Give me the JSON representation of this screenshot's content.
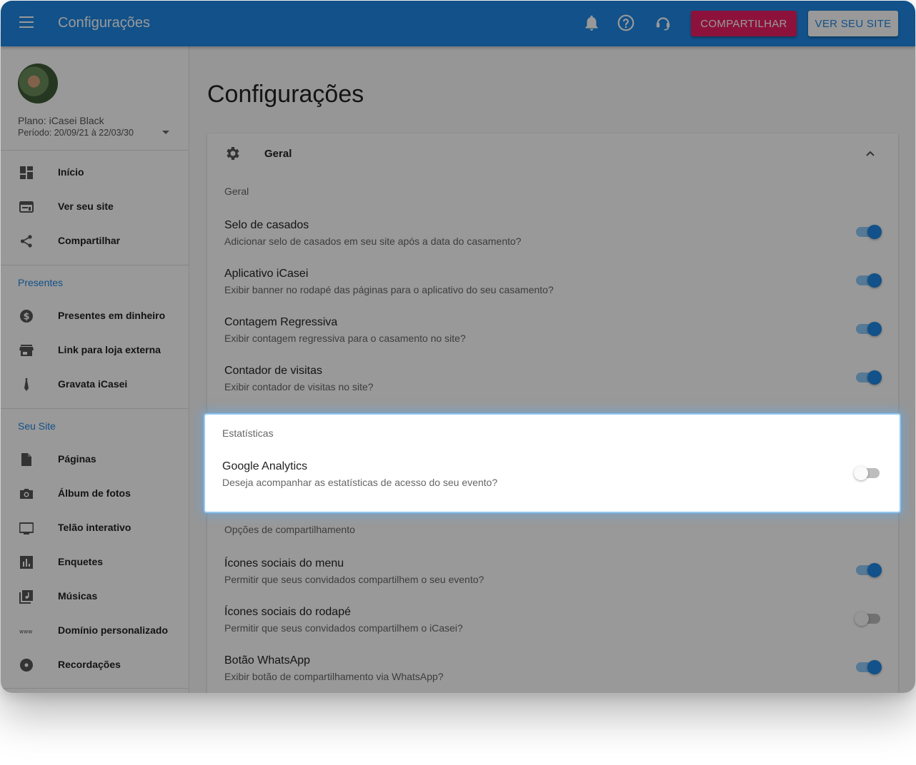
{
  "header": {
    "title": "Configurações",
    "share_label": "COMPARTILHAR",
    "view_site_label": "VER SEU SITE",
    "brand_color": "#1e88e5",
    "accent_color": "#e91e63"
  },
  "sidebar": {
    "plan": "Plano: iCasei Black",
    "period": "Período: 20/09/21 à 22/03/30",
    "items": [
      {
        "label": "Início",
        "icon": "dashboard-icon"
      },
      {
        "label": "Ver seu site",
        "icon": "web-icon"
      },
      {
        "label": "Compartilhar",
        "icon": "share-icon"
      }
    ],
    "presentes_title": "Presentes",
    "presentes": [
      {
        "label": "Presentes em dinheiro",
        "icon": "money-icon"
      },
      {
        "label": "Link para loja externa",
        "icon": "store-icon"
      },
      {
        "label": "Gravata iCasei",
        "icon": "tie-icon"
      }
    ],
    "site_title": "Seu Site",
    "site": [
      {
        "label": "Páginas",
        "icon": "page-icon"
      },
      {
        "label": "Álbum de fotos",
        "icon": "camera-icon"
      },
      {
        "label": "Telão interativo",
        "icon": "screen-icon"
      },
      {
        "label": "Enquetes",
        "icon": "poll-icon"
      },
      {
        "label": "Músicas",
        "icon": "music-icon"
      },
      {
        "label": "Domínio personalizado",
        "icon": "www-icon"
      },
      {
        "label": "Recordações",
        "icon": "disc-icon"
      }
    ]
  },
  "main": {
    "page_title": "Configurações",
    "card_title": "Geral",
    "sections": [
      {
        "title": "Geral",
        "settings": [
          {
            "title": "Selo de casados",
            "desc": "Adicionar selo de casados em seu site após a data do casamento?",
            "on": true
          },
          {
            "title": "Aplicativo iCasei",
            "desc": "Exibir banner no rodapé das páginas para o aplicativo do seu casamento?",
            "on": true
          },
          {
            "title": "Contagem Regressiva",
            "desc": "Exibir contagem regressiva para o casamento no site?",
            "on": true
          },
          {
            "title": "Contador de visitas",
            "desc": "Exibir contador de visitas no site?",
            "on": true
          }
        ]
      },
      {
        "title": "Estatísticas",
        "settings": [
          {
            "title": "Google Analytics",
            "desc": "Deseja acompanhar as estatísticas de acesso do seu evento?",
            "on": false
          }
        ]
      },
      {
        "title": "Opções de compartilhamento",
        "settings": [
          {
            "title": "Ícones sociais do menu",
            "desc": "Permitir que seus convidados compartilhem o seu evento?",
            "on": true
          },
          {
            "title": "Ícones sociais do rodapé",
            "desc": "Permitir que seus convidados compartilhem o iCasei?",
            "on": false
          },
          {
            "title": "Botão WhatsApp",
            "desc": "Exibir botão de compartilhamento via WhatsApp?",
            "on": true
          }
        ]
      }
    ]
  }
}
